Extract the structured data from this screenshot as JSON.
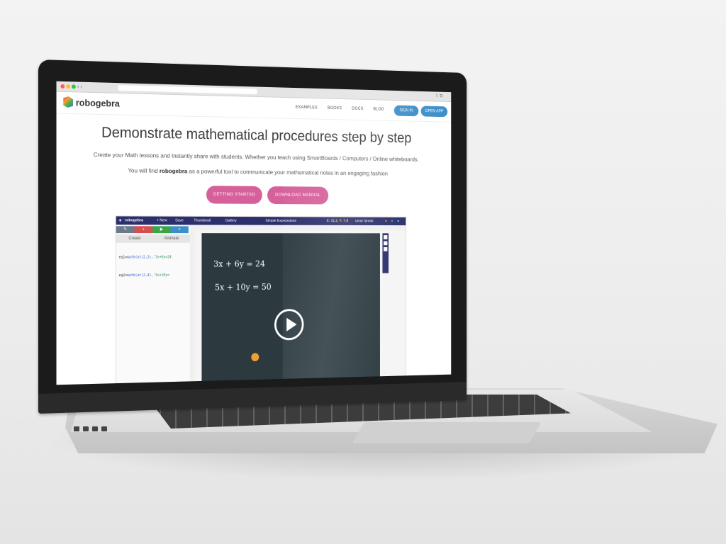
{
  "site": {
    "logo_text": "robogebra",
    "nav": {
      "examples": "EXAMPLES",
      "books": "BOOKS",
      "docs": "DOCS",
      "blog": "BLOG",
      "sign_in": "SIGN IN",
      "open_app": "OPEN APP"
    }
  },
  "hero": {
    "title": "Demonstrate mathematical procedures step by step",
    "subtitle_1": "Create your Math lessons and Instantly share with students. Whether you teach using SmartBoards / Computers / Online whiteboards,",
    "subtitle_2_prefix": "You will find ",
    "subtitle_2_brand": "robogebra",
    "subtitle_2_suffix": " as a powerful tool to communicate your mathematical notes in an engaging fashion",
    "btn_getting_started": "GETTING STARTED",
    "btn_download_manual": "DOWNLOAD MANUAL"
  },
  "app_preview": {
    "brand": "robogebra",
    "menu_new": "+ New",
    "menu_save": "Save",
    "menu_thumbnail": "Thumbnail",
    "menu_gallery": "Gallery",
    "doc_title": "Simple Expressions",
    "coords": "X: 11.2, Y: 7.9",
    "user": "umar farook",
    "tab_create": "Create",
    "tab_animate": "Animate",
    "code_1_prefix": "eq1=",
    "code_1_fn": "math(at(2,2),",
    "code_1_str": "'3x+6y=24",
    "code_2_prefix": "eq2=",
    "code_2_fn": "math(at(2,4),",
    "code_2_str": "'5x+10y=",
    "eq_1": "3x + 6y = 24",
    "eq_2": "5x + 10y = 50"
  },
  "colors": {
    "header_pill": "#3e8fc9",
    "hero_button": "#d6609a",
    "app_bar": "#2b2f6b",
    "board": "#2c3a40"
  }
}
